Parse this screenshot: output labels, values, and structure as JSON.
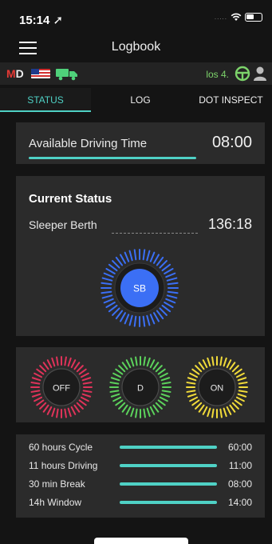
{
  "statusbar": {
    "time": "15:14",
    "dots": "....."
  },
  "header": {
    "title": "Logbook"
  },
  "indicators": {
    "md_m": "M",
    "md_d": "D",
    "los": "los 4."
  },
  "tabs": [
    {
      "label": "STATUS",
      "active": true
    },
    {
      "label": "LOG",
      "active": false
    },
    {
      "label": "DOT INSPECT",
      "active": false
    }
  ],
  "available": {
    "label": "Available Driving Time",
    "value": "08:00"
  },
  "current": {
    "title": "Current Status",
    "status": "Sleeper Berth",
    "hours": "136:18",
    "dial_label": "SB"
  },
  "status_buttons": [
    {
      "label": "OFF",
      "color": "#e0335a"
    },
    {
      "label": "D",
      "color": "#5cd35c"
    },
    {
      "label": "ON",
      "color": "#f2dc3a"
    }
  ],
  "summary": [
    {
      "label": "60 hours Cycle",
      "value": "60:00",
      "fill": 1.0
    },
    {
      "label": "11 hours Driving",
      "value": "11:00",
      "fill": 1.0
    },
    {
      "label": "30 min Break",
      "value": "08:00",
      "fill": 1.0
    },
    {
      "label": "14h Window",
      "value": "14:00",
      "fill": 1.0
    }
  ],
  "colors": {
    "accent": "#4fd1c5",
    "sb_blue": "#3b6ff5",
    "panel": "#2b2b2b"
  }
}
